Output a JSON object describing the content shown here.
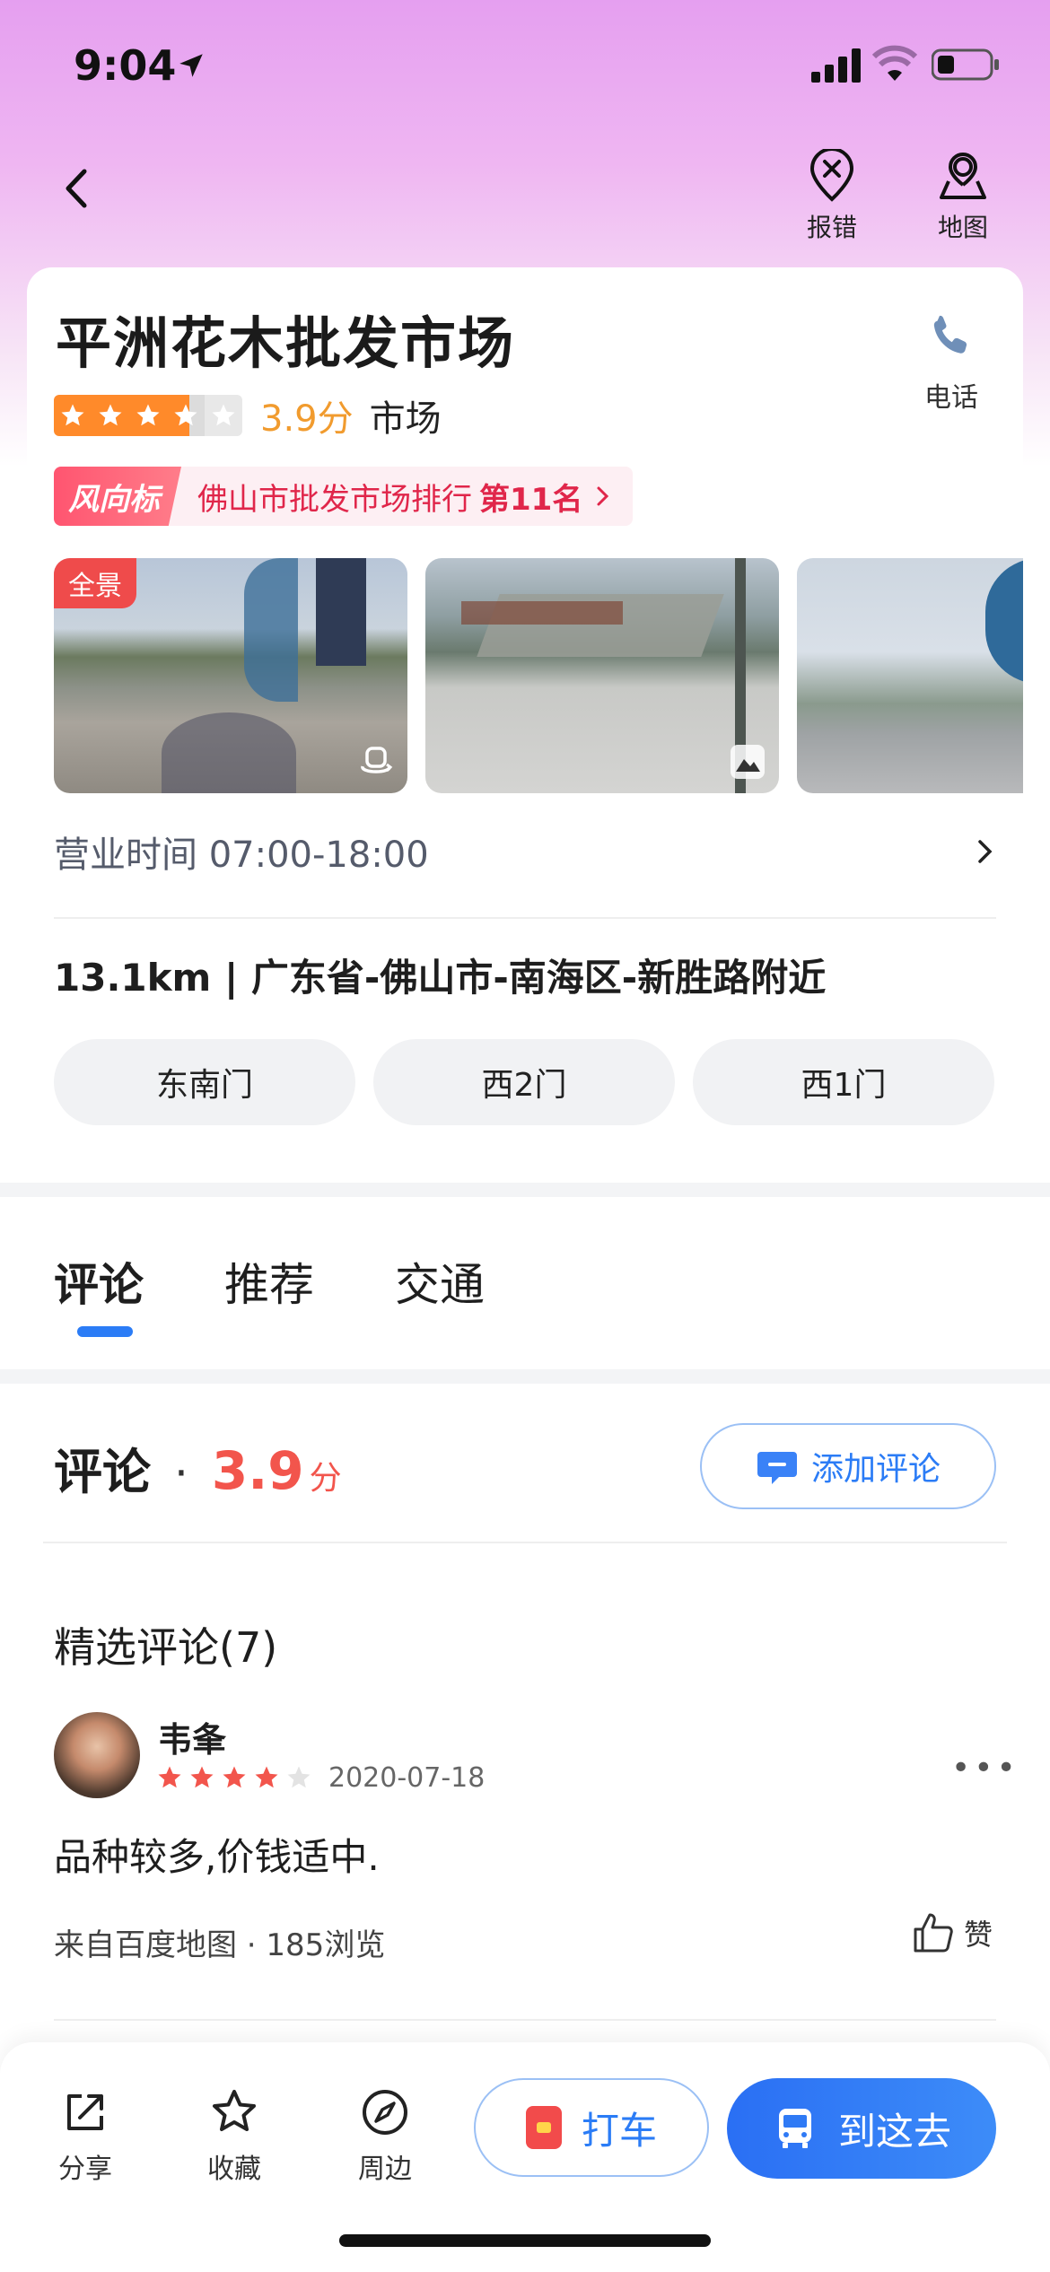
{
  "status": {
    "time": "9:04"
  },
  "header": {
    "report_label": "报错",
    "map_label": "地图"
  },
  "place": {
    "name": "平洲花木批发市场",
    "rating": 3.9,
    "score_text": "3.9分",
    "category": "市场",
    "phone_label": "电话",
    "rank": {
      "logo": "风向标",
      "text": "佛山市批发市场排行",
      "position": "第11名"
    },
    "photos": [
      {
        "tag": "全景",
        "icon": "panorama-360-icon"
      },
      {
        "icon": "photo-icon"
      },
      {}
    ],
    "hours_label": "营业时间 07:00-18:00",
    "address": "13.1km | 广东省-佛山市-南海区-新胜路附近",
    "gates": [
      "东南门",
      "西2门",
      "西1门"
    ]
  },
  "tabs": [
    {
      "label": "评论",
      "active": true
    },
    {
      "label": "推荐",
      "active": false
    },
    {
      "label": "交通",
      "active": false
    }
  ],
  "reviews": {
    "title": "评论",
    "score": "3.9",
    "score_unit": "分",
    "add_label": "添加评论",
    "featured_label": "精选评论(7)",
    "items": [
      {
        "user": "韦夆",
        "stars": 4,
        "date": "2020-07-18",
        "text": "品种较多,价钱适中.",
        "meta": "来自百度地图 · 185浏览",
        "like_label": "赞"
      }
    ]
  },
  "bottom_bar": {
    "share": "分享",
    "favorite": "收藏",
    "nearby": "周边",
    "taxi": "打车",
    "go": "到这去"
  },
  "colors": {
    "accent_blue": "#2b7cf6",
    "star_orange": "#ff8a2a",
    "score_red": "#f2554c",
    "rank_red": "#e0264a",
    "hero_pink": "#e59ff0"
  }
}
